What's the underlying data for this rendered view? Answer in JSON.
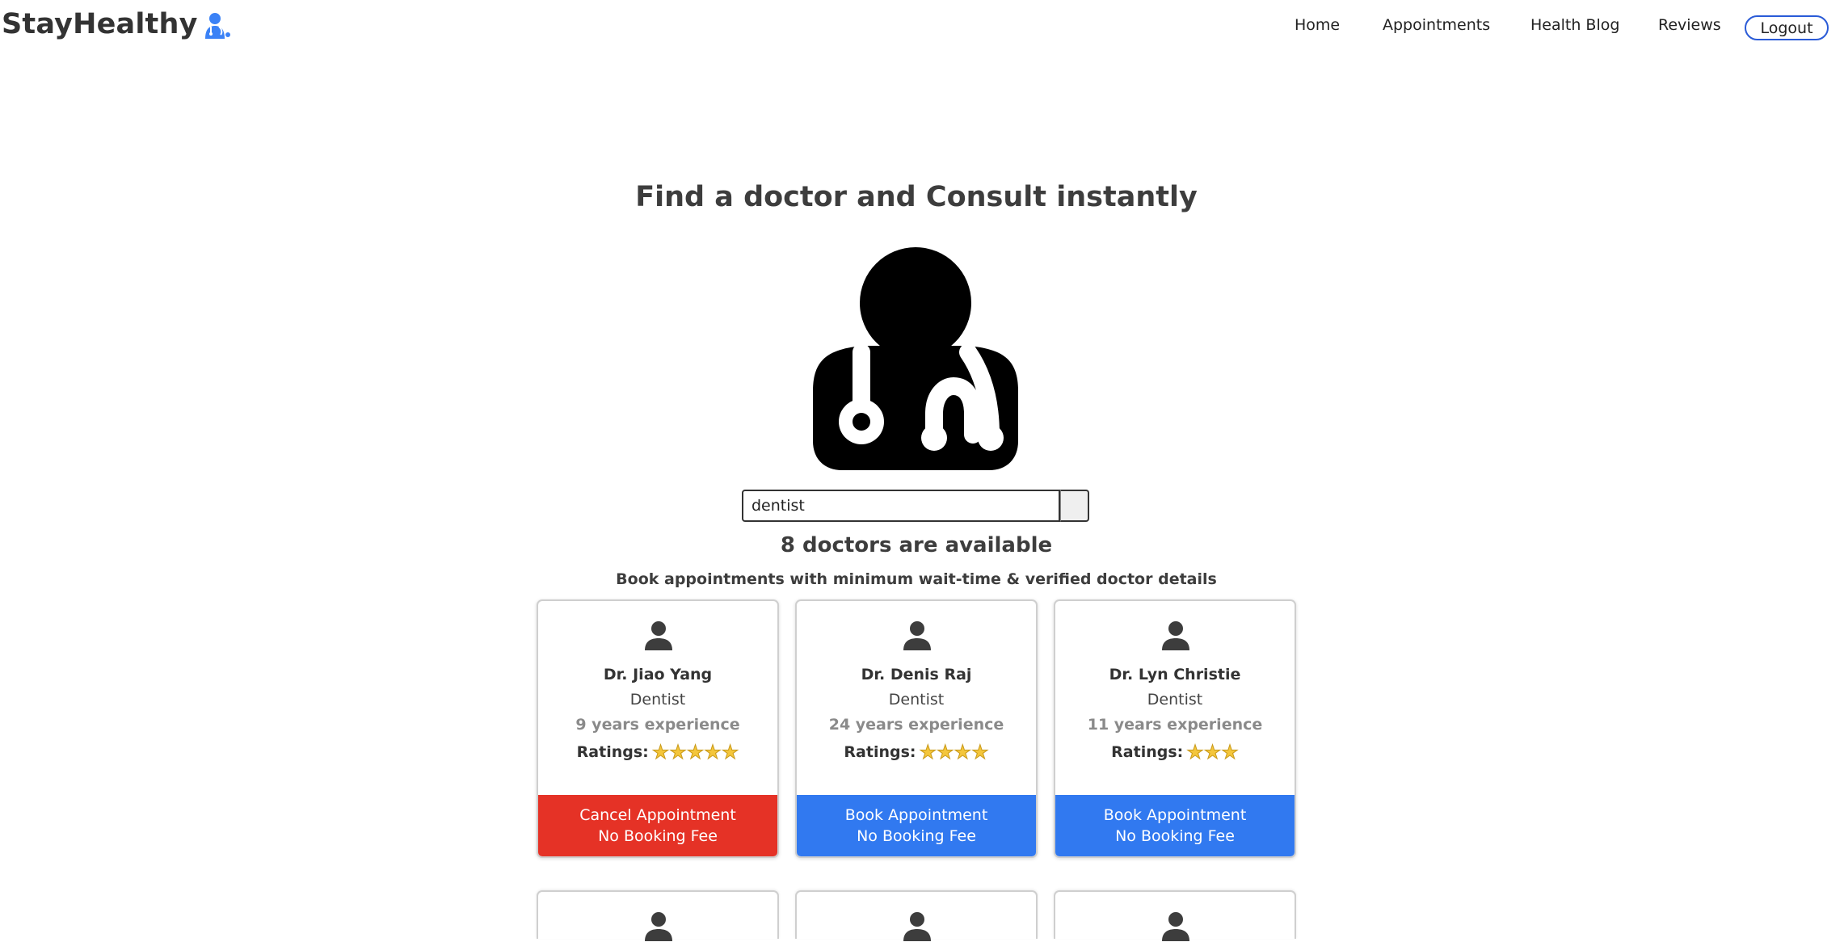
{
  "brand": {
    "name": "StayHealthy",
    "accent": "#3b82f6"
  },
  "nav": {
    "links": [
      "Home",
      "Appointments",
      "Health Blog",
      "Reviews"
    ],
    "logout": "Logout"
  },
  "hero": {
    "title": "Find a doctor and Consult instantly"
  },
  "search": {
    "value": "dentist",
    "placeholder": ""
  },
  "results": {
    "count_text": "8 doctors are available",
    "subtitle": "Book appointments with minimum wait-time & verified doctor details"
  },
  "doctors": [
    {
      "name": "Dr. Jiao Yang",
      "specialty": "Dentist",
      "experience": "9 years experience",
      "rating_label": "Ratings:",
      "stars": 5,
      "button_line1": "Cancel Appointment",
      "button_line2": "No Booking Fee",
      "button_type": "cancel"
    },
    {
      "name": "Dr. Denis Raj",
      "specialty": "Dentist",
      "experience": "24 years experience",
      "rating_label": "Ratings:",
      "stars": 4,
      "button_line1": "Book Appointment",
      "button_line2": "No Booking Fee",
      "button_type": "book"
    },
    {
      "name": "Dr. Lyn Christie",
      "specialty": "Dentist",
      "experience": "11 years experience",
      "rating_label": "Ratings:",
      "stars": 3,
      "button_line1": "Book Appointment",
      "button_line2": "No Booking Fee",
      "button_type": "book"
    }
  ],
  "colors": {
    "cancel": "#e53226",
    "book": "#3179f0",
    "star": "#f4c63b"
  }
}
